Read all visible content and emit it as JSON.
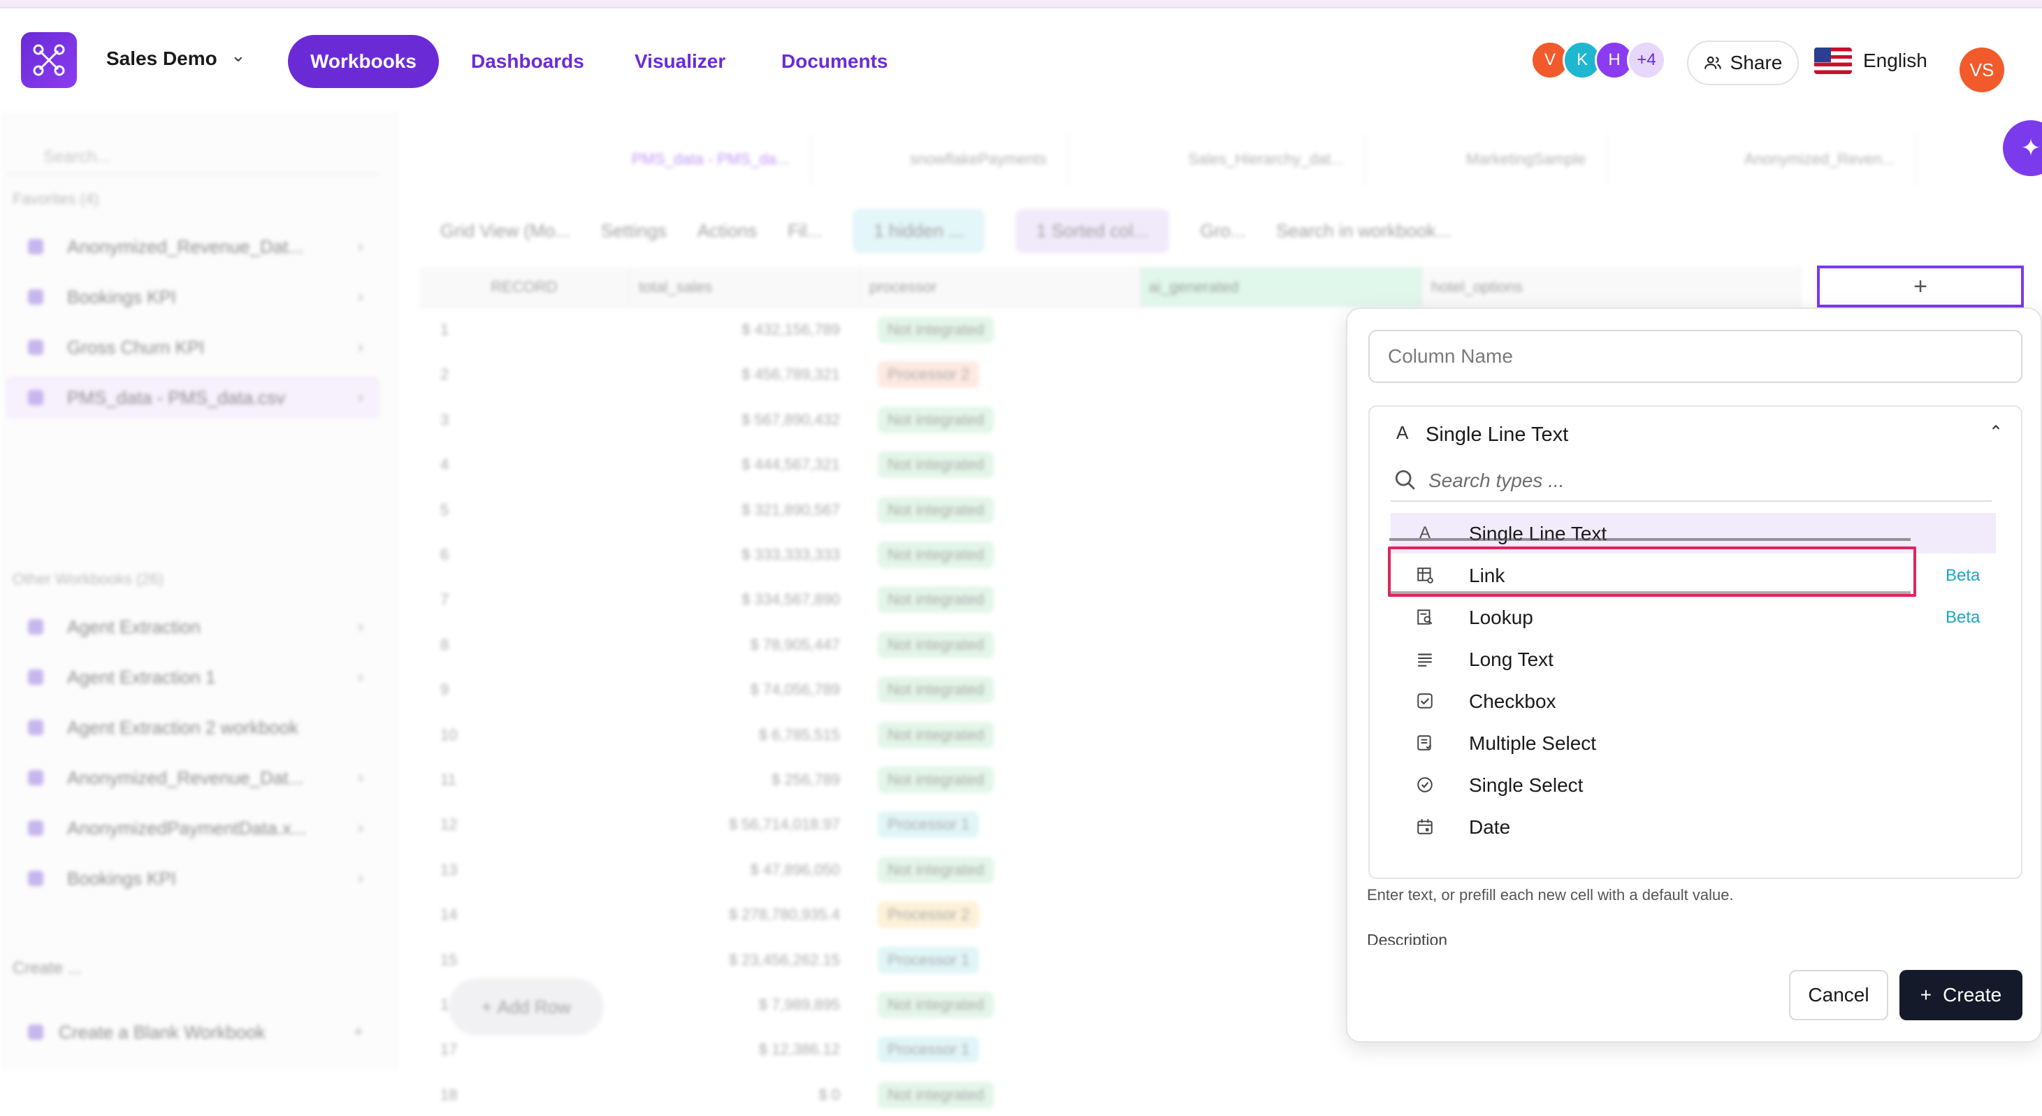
{
  "header": {
    "workspace_name": "Sales Demo",
    "nav": [
      "Workbooks",
      "Dashboards",
      "Visualizer",
      "Documents"
    ],
    "active_nav": "Workbooks",
    "avatars": [
      {
        "initial": "V",
        "color": "#f25a2b"
      },
      {
        "initial": "K",
        "color": "#1fb6d0"
      },
      {
        "initial": "H",
        "color": "#8b3cf0"
      }
    ],
    "avatars_more": "+4",
    "share_label": "Share",
    "language": "English",
    "user_initials": "VS"
  },
  "sidebar": {
    "search_placeholder": "Search...",
    "favorites_label": "Favorites (4)",
    "favorites": [
      "Anonymized_Revenue_Dat...",
      "Bookings KPI",
      "Gross Churn KPI",
      "PMS_data - PMS_data.csv"
    ],
    "other_label": "Other Workbooks (26)",
    "other": [
      "Agent Extraction",
      "Agent Extraction 1",
      "Agent Extraction 2 workbook",
      "Anonymized_Revenue_Dat...",
      "AnonymizedPaymentData.x...",
      "Bookings KPI"
    ],
    "create_label": "Create ...",
    "create_blank": "Create a Blank Workbook"
  },
  "tabs": [
    "PMS_data - PMS_da...",
    "snowflakePayments",
    "Sales_Hierarchy_dat...",
    "MarketingSample",
    "Anonymized_Reven..."
  ],
  "toolbar": [
    "Grid View (Mo...",
    "Settings",
    "Actions",
    "Fil...",
    "1 hidden ...",
    "1 Sorted col...",
    "Gro...",
    "Search in workbook..."
  ],
  "grid": {
    "headers": [
      "RECORD",
      "total_sales",
      "processor",
      "ai_generated",
      "hotel_options"
    ],
    "rows": [
      {
        "n": "1",
        "v": "$ 432,156,789",
        "p": "Not integrated",
        "c": "#cdeed6"
      },
      {
        "n": "2",
        "v": "$ 456,789,321",
        "p": "Processor 2",
        "c": "#fbd8c8"
      },
      {
        "n": "3",
        "v": "$ 567,890,432",
        "p": "Not integrated",
        "c": "#cdeed6"
      },
      {
        "n": "4",
        "v": "$ 444,567,321",
        "p": "Not integrated",
        "c": "#cdeed6"
      },
      {
        "n": "5",
        "v": "$ 321,890,567",
        "p": "Not integrated",
        "c": "#cdeed6"
      },
      {
        "n": "6",
        "v": "$ 333,333,333",
        "p": "Not integrated",
        "c": "#cdeed6"
      },
      {
        "n": "7",
        "v": "$ 334,567,890",
        "p": "Not integrated",
        "c": "#cdeed6"
      },
      {
        "n": "8",
        "v": "$ 78,905,447",
        "p": "Not integrated",
        "c": "#cdeed6"
      },
      {
        "n": "9",
        "v": "$ 74,056,789",
        "p": "Not integrated",
        "c": "#cdeed6"
      },
      {
        "n": "10",
        "v": "$ 6,785,515",
        "p": "Not integrated",
        "c": "#cdeed6"
      },
      {
        "n": "11",
        "v": "$ 256,789",
        "p": "Not integrated",
        "c": "#cdeed6"
      },
      {
        "n": "12",
        "v": "$ 56,714,018.97",
        "p": "Processor 1",
        "c": "#c8eef2"
      },
      {
        "n": "13",
        "v": "$ 47,896,050",
        "p": "Not integrated",
        "c": "#cdeed6"
      },
      {
        "n": "14",
        "v": "$ 278,780,935.4",
        "p": "Processor 2",
        "c": "#fbe5b8"
      },
      {
        "n": "15",
        "v": "$ 23,456,262.15",
        "p": "Processor 1",
        "c": "#c8eef2"
      },
      {
        "n": "16",
        "v": "$ 7,989,895",
        "p": "Not integrated",
        "c": "#cdeed6"
      },
      {
        "n": "17",
        "v": "$ 12,386.12",
        "p": "Processor 1",
        "c": "#c8eef2"
      },
      {
        "n": "18",
        "v": "$ 0",
        "p": "Not integrated",
        "c": "#cdeed6"
      }
    ],
    "add_row_label": "Add Row",
    "add_column_icon": "+"
  },
  "panel": {
    "column_name_placeholder": "Column Name",
    "selected_type": "Single Line Text",
    "type_search_placeholder": "Search types ...",
    "options": [
      {
        "label": "Single Line Text",
        "icon": "text-a-icon",
        "beta": ""
      },
      {
        "label": "Link",
        "icon": "link-table-icon",
        "beta": "Beta"
      },
      {
        "label": "Lookup",
        "icon": "lookup-icon",
        "beta": "Beta"
      },
      {
        "label": "Long Text",
        "icon": "long-text-icon",
        "beta": ""
      },
      {
        "label": "Checkbox",
        "icon": "checkbox-icon",
        "beta": ""
      },
      {
        "label": "Multiple Select",
        "icon": "multi-select-icon",
        "beta": ""
      },
      {
        "label": "Single Select",
        "icon": "single-select-icon",
        "beta": ""
      },
      {
        "label": "Date",
        "icon": "calendar-icon",
        "beta": ""
      }
    ],
    "hint": "Enter text, or prefill each new cell with a default value.",
    "description_label": "Description",
    "cancel_label": "Cancel",
    "create_label": "Create"
  },
  "colors": {
    "accent": "#6a2bd6",
    "highlight": "#e0245e",
    "beta": "#1ba6c4",
    "create_button": "#141a2a"
  }
}
